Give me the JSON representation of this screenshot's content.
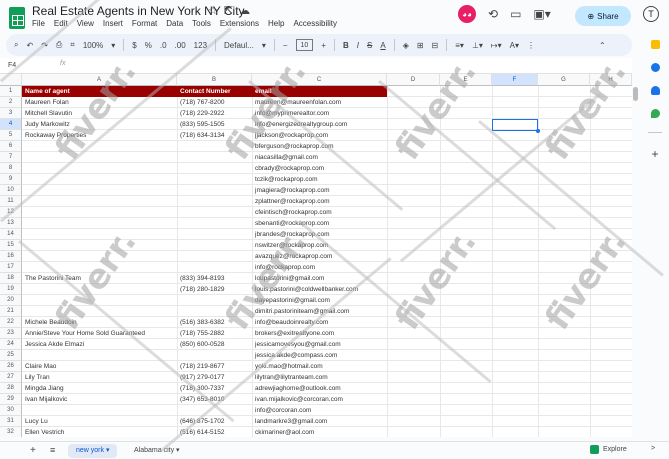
{
  "doc": {
    "title": "Real Estate Agents in New York NY City",
    "menu": [
      "File",
      "Edit",
      "View",
      "Insert",
      "Format",
      "Data",
      "Tools",
      "Extensions",
      "Help",
      "Accessibility"
    ],
    "share_label": "Share",
    "account_initial": "T"
  },
  "toolbar": {
    "zoom": "100%",
    "currency": "$",
    "percent": "%",
    "dec_less": ".0",
    "dec_more": ".00",
    "num_format": "123",
    "font": "Defaul...",
    "font_size": "10",
    "bold": "B",
    "italic": "I",
    "strike": "S",
    "text_color": "A"
  },
  "formula_bar": {
    "cell_ref": "F4",
    "fx": "fx",
    "value": ""
  },
  "columns": [
    "A",
    "B",
    "C",
    "D",
    "E",
    "F",
    "G",
    "H"
  ],
  "rows": [
    {
      "n": "1",
      "a": "Name of agent",
      "b": "Contact Number",
      "c": "email"
    },
    {
      "n": "2",
      "a": "Maureen Folan",
      "b": "(718) 767-8200",
      "c": "maureen@maureenfolan.com"
    },
    {
      "n": "3",
      "a": "Mitchell Slavutin",
      "b": "(718) 229-2922",
      "c": "info@myprimerealtor.com"
    },
    {
      "n": "4",
      "a": "Judy Markowitz",
      "b": "(833) 595-1505",
      "c": "info@energizedrealtygroup.com"
    },
    {
      "n": "5",
      "a": "Rockaway Properties",
      "b": "(718) 634-3134",
      "c": "jjackson@rockaprop.com"
    },
    {
      "n": "6",
      "a": "",
      "b": "",
      "c": "bferguson@rockaprop.com"
    },
    {
      "n": "7",
      "a": "",
      "b": "",
      "c": "niacasilla@gmail.com"
    },
    {
      "n": "8",
      "a": "",
      "b": "",
      "c": "cbrady@rockaprop.com"
    },
    {
      "n": "9",
      "a": "",
      "b": "",
      "c": "tczik@rockaprop.com"
    },
    {
      "n": "10",
      "a": "",
      "b": "",
      "c": "jmagiera@rockaprop.com"
    },
    {
      "n": "11",
      "a": "",
      "b": "",
      "c": "zplattner@rockaprop.com"
    },
    {
      "n": "12",
      "a": "",
      "b": "",
      "c": "cfeintisch@rockaprop.com"
    },
    {
      "n": "13",
      "a": "",
      "b": "",
      "c": "sbenanti@rockaprop.com"
    },
    {
      "n": "14",
      "a": "",
      "b": "",
      "c": "jbrandes@rockaprop.com"
    },
    {
      "n": "15",
      "a": "",
      "b": "",
      "c": "nswitzer@rockaprop.com"
    },
    {
      "n": "16",
      "a": "",
      "b": "",
      "c": "avazquez@rockaprop.com"
    },
    {
      "n": "17",
      "a": "",
      "b": "",
      "c": "info@rockaprop.com"
    },
    {
      "n": "18",
      "a": "The Pastorini Team",
      "b": "(833) 394-8193",
      "c": "loupastorini@gmail.com"
    },
    {
      "n": "19",
      "a": "",
      "b": "(718) 280-1829",
      "c": "louis.pastorini@coldwellbanker.com"
    },
    {
      "n": "20",
      "a": "",
      "b": "",
      "c": "dayepastorini@gmail.com"
    },
    {
      "n": "21",
      "a": "",
      "b": "",
      "c": "dimitri.pastoriniteam@gmail.com"
    },
    {
      "n": "22",
      "a": "Michele Beaudoin",
      "b": "(516) 383-6382",
      "c": "info@beaudoinrealty.com"
    },
    {
      "n": "23",
      "a": "Annie/Steve Your Home Sold Guaranteed",
      "b": "(718) 755-2882",
      "c": "brokers@exitrealtyone.com"
    },
    {
      "n": "24",
      "a": "Jessica Akde Elmazi",
      "b": "(850) 600-0528",
      "c": "jessicamovesyou@gmail.com"
    },
    {
      "n": "25",
      "a": "",
      "b": "",
      "c": "jessica.akde@compass.com"
    },
    {
      "n": "26",
      "a": "Claire Mao",
      "b": "(718) 219-8677",
      "c": "yoki.mao@hotmail.com"
    },
    {
      "n": "27",
      "a": "Lily Tran",
      "b": "(917) 279-0177",
      "c": "lilytran@lilytranteam.com"
    },
    {
      "n": "28",
      "a": "Mingda Jiang",
      "b": "(718) 300-7337",
      "c": "adrewjiaghome@outlook.com"
    },
    {
      "n": "29",
      "a": "Ivan Mijalkovic",
      "b": "(347) 653-8010",
      "c": "ivan.mijalkovic@corcoran.com"
    },
    {
      "n": "30",
      "a": "",
      "b": "",
      "c": "info@corcoran.com"
    },
    {
      "n": "31",
      "a": "Lucy Lu",
      "b": "(646) 875-1702",
      "c": "landmarkre3@gmail.com"
    },
    {
      "n": "32",
      "a": "Ellen Vestrich",
      "b": "(516) 614-5152",
      "c": "ckimariner@aol.com"
    }
  ],
  "sheets": [
    {
      "label": "new york",
      "active": true
    },
    {
      "label": "Alabama city",
      "active": false
    }
  ],
  "explore_label": "Explore",
  "watermark": "fiverr."
}
